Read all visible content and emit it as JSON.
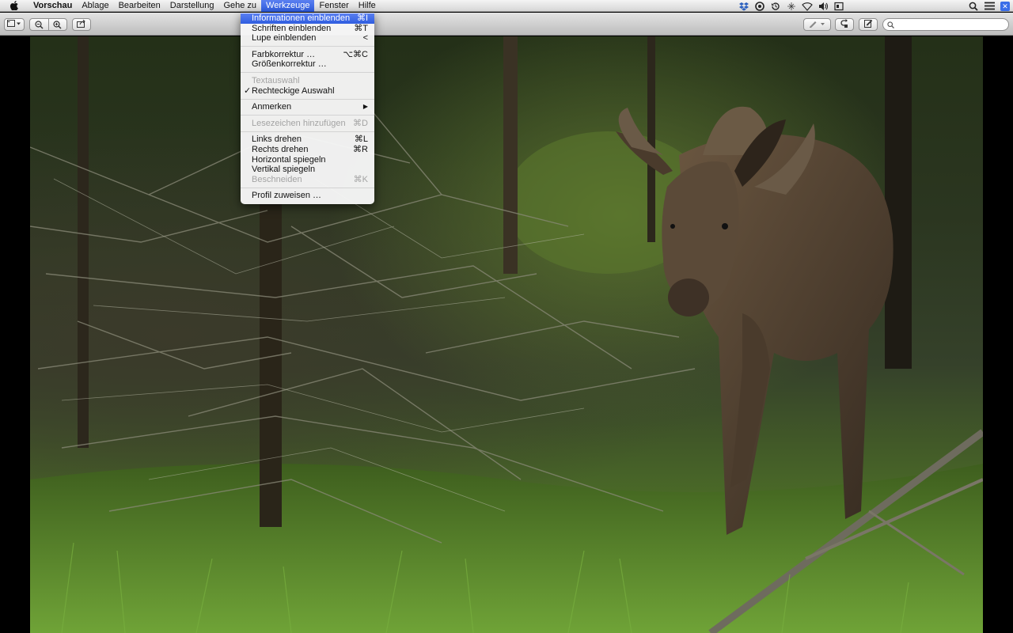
{
  "menubar": {
    "apple_icon": "apple-icon",
    "app_name": "Vorschau",
    "items": [
      "Ablage",
      "Bearbeiten",
      "Darstellung",
      "Gehe zu",
      "Werkzeuge",
      "Fenster",
      "Hilfe"
    ],
    "active_menu": "Werkzeuge",
    "extras": [
      "dropbox-icon",
      "sync-icon",
      "time-machine-icon",
      "bluetooth-icon",
      "wifi-icon",
      "volume-icon",
      "display-icon",
      "spotlight-icon",
      "list-icon",
      "notification-icon"
    ]
  },
  "toolbar": {
    "sidebar_button_icon": "sidebar-icon",
    "zoom_out_icon": "zoom-out-icon",
    "zoom_in_icon": "zoom-in-icon",
    "share_icon": "share-icon",
    "annotate_icon": "pen-icon",
    "rotate_icon": "rotate-icon",
    "edit_icon": "edit-icon",
    "search": {
      "value": "",
      "placeholder": ""
    }
  },
  "tools_menu": {
    "items": [
      {
        "label": "Informationen einblenden",
        "shortcut": "⌘I",
        "state": "highlight"
      },
      {
        "label": "Schriften einblenden",
        "shortcut": "⌘T"
      },
      {
        "label": "Lupe einblenden",
        "shortcut": "<"
      },
      {
        "sep": true
      },
      {
        "label": "Farbkorrektur …",
        "shortcut": "⌥⌘C"
      },
      {
        "label": "Größenkorrektur …",
        "shortcut": ""
      },
      {
        "sep": true
      },
      {
        "label": "Textauswahl",
        "shortcut": "",
        "state": "disabled"
      },
      {
        "label": "Rechteckige Auswahl",
        "shortcut": "",
        "checked": true
      },
      {
        "sep": true
      },
      {
        "label": "Anmerken",
        "shortcut": "▶"
      },
      {
        "sep": true
      },
      {
        "label": "Lesezeichen hinzufügen",
        "shortcut": "⌘D",
        "state": "disabled"
      },
      {
        "sep": true
      },
      {
        "label": "Links drehen",
        "shortcut": "⌘L"
      },
      {
        "label": "Rechts drehen",
        "shortcut": "⌘R"
      },
      {
        "label": "Horizontal spiegeln",
        "shortcut": ""
      },
      {
        "label": "Vertikal spiegeln",
        "shortcut": ""
      },
      {
        "label": "Beschneiden",
        "shortcut": "⌘K",
        "state": "disabled"
      },
      {
        "sep": true
      },
      {
        "label": "Profil zuweisen …",
        "shortcut": ""
      }
    ]
  },
  "colors": {
    "menu_highlight": "#3a66e6",
    "foliage": "#5f8a2e",
    "moose": "#4a3a2c"
  }
}
